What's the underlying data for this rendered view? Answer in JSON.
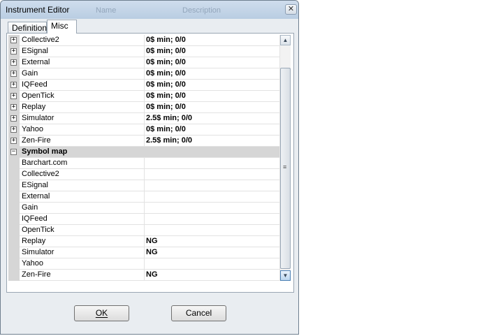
{
  "window": {
    "title": "Instrument Editor",
    "ghost_headers": [
      "Name",
      "Description"
    ],
    "close_glyph": "✕"
  },
  "tabs": [
    {
      "label": "Definition",
      "active": false
    },
    {
      "label": "Misc",
      "active": true
    }
  ],
  "commission_rows": [
    {
      "name": "Collective2",
      "value": "0$ min;  0/0",
      "expander": "+"
    },
    {
      "name": "ESignal",
      "value": "0$ min;  0/0",
      "expander": "+"
    },
    {
      "name": "External",
      "value": "0$ min;  0/0",
      "expander": "+"
    },
    {
      "name": "Gain",
      "value": "0$ min;  0/0",
      "expander": "+"
    },
    {
      "name": "IQFeed",
      "value": "0$ min;  0/0",
      "expander": "+"
    },
    {
      "name": "OpenTick",
      "value": "0$ min;  0/0",
      "expander": "+"
    },
    {
      "name": "Replay",
      "value": "0$ min;  0/0",
      "expander": "+"
    },
    {
      "name": "Simulator",
      "value": "2.5$ min;  0/0",
      "expander": "+"
    },
    {
      "name": "Yahoo",
      "value": "0$ min;  0/0",
      "expander": "+"
    },
    {
      "name": "Zen-Fire",
      "value": "2.5$ min;  0/0",
      "expander": "+"
    }
  ],
  "symbol_map": {
    "label": "Symbol map",
    "expander": "−",
    "rows": [
      {
        "name": "Barchart.com",
        "value": ""
      },
      {
        "name": "Collective2",
        "value": ""
      },
      {
        "name": "ESignal",
        "value": ""
      },
      {
        "name": "External",
        "value": ""
      },
      {
        "name": "Gain",
        "value": ""
      },
      {
        "name": "IQFeed",
        "value": ""
      },
      {
        "name": "OpenTick",
        "value": ""
      },
      {
        "name": "Replay",
        "value": "NG"
      },
      {
        "name": "Simulator",
        "value": "NG"
      },
      {
        "name": "Yahoo",
        "value": ""
      },
      {
        "name": "Zen-Fire",
        "value": "NG"
      }
    ]
  },
  "scrollbar": {
    "up": "▲",
    "down": "▼",
    "grip": "≡"
  },
  "buttons": {
    "ok": "OK",
    "cancel": "Cancel"
  }
}
